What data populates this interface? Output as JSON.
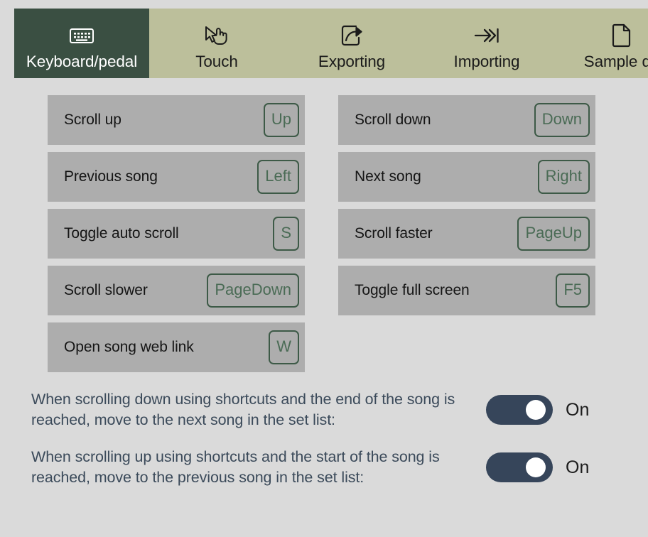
{
  "tabs": [
    {
      "label": "Keyboard/pedal",
      "icon": "keyboard-icon",
      "active": true
    },
    {
      "label": "Touch",
      "icon": "touch-pointer-icon",
      "active": false
    },
    {
      "label": "Exporting",
      "icon": "export-share-icon",
      "active": false
    },
    {
      "label": "Importing",
      "icon": "import-arrow-icon",
      "active": false
    },
    {
      "label": "Sample da",
      "icon": "document-page-icon",
      "active": false
    }
  ],
  "shortcuts": {
    "left": [
      {
        "action": "Scroll up",
        "key": "Up"
      },
      {
        "action": "Previous song",
        "key": "Left"
      },
      {
        "action": "Toggle auto scroll",
        "key": "S"
      },
      {
        "action": "Scroll slower",
        "key": "PageDown"
      },
      {
        "action": "Open song web link",
        "key": "W"
      }
    ],
    "right": [
      {
        "action": "Scroll down",
        "key": "Down"
      },
      {
        "action": "Next song",
        "key": "Right"
      },
      {
        "action": "Scroll faster",
        "key": "PageUp"
      },
      {
        "action": "Toggle full screen",
        "key": "F5"
      }
    ]
  },
  "settings": [
    {
      "text": "When scrolling down using shortcuts and the end of the song is reached, move to the next song in the set list:",
      "state": "On"
    },
    {
      "text": "When scrolling up using shortcuts and the start of the song is reached, move to the previous song in the set list:",
      "state": "On"
    }
  ],
  "colors": {
    "page_background": "#dadada",
    "tabbar_background": "#bcbf9b",
    "active_tab": "#3a4f42",
    "row_background": "#adadad",
    "keycap_border": "#3d5a47",
    "keycap_text": "#4a6b55",
    "toggle_on": "#36455a",
    "setting_text": "#3b4a5a"
  }
}
